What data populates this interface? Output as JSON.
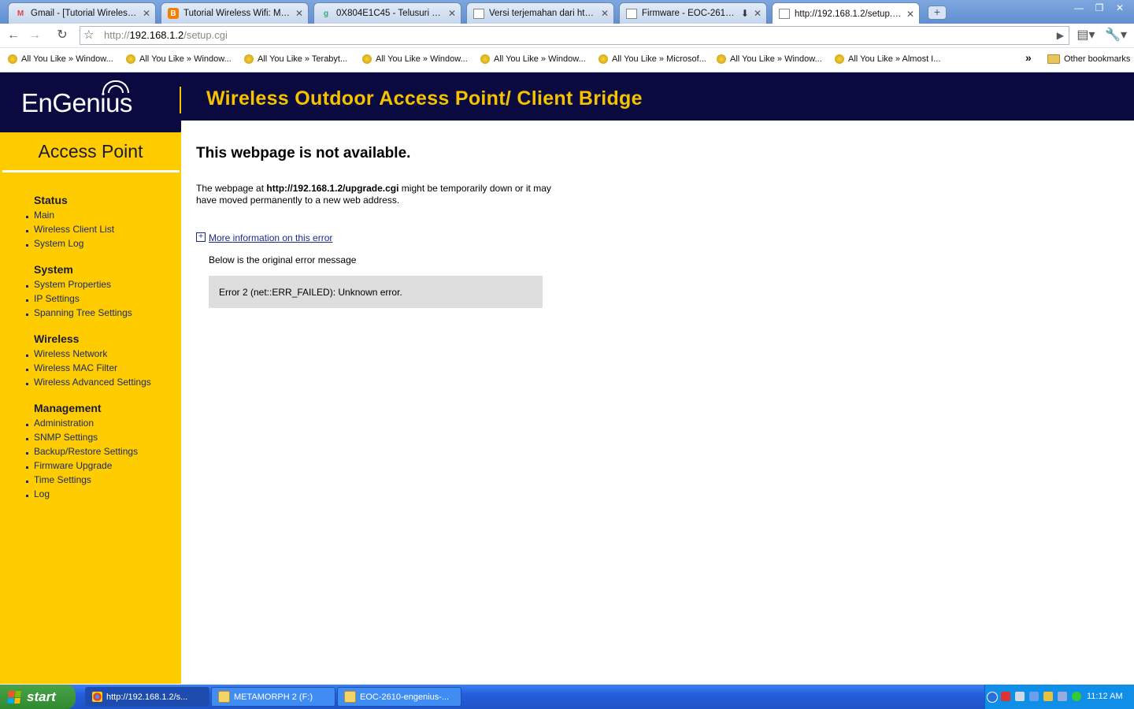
{
  "browser": {
    "tabs": [
      {
        "title": "Gmail - [Tutorial Wireless W...",
        "icon": "gmail-icon",
        "active": false
      },
      {
        "title": "Tutorial Wireless Wifi: Men...",
        "icon": "blogger-icon",
        "active": false
      },
      {
        "title": "0X804E1C45 - Telusuri den...",
        "icon": "google-icon",
        "active": false
      },
      {
        "title": "Versi terjemahan dari http:...",
        "icon": "page-icon",
        "active": false
      },
      {
        "title": "Firmware - EOC-2610 - ...",
        "icon": "page-icon",
        "active": false
      },
      {
        "title": "http://192.168.1.2/setup.cgi",
        "icon": "page-icon",
        "active": true
      }
    ],
    "address": {
      "prefix": "http://",
      "host": "192.168.1.2",
      "path": "/setup.cgi"
    },
    "bookmarks": [
      "All You Like » Window...",
      "All You Like » Window...",
      "All You Like » Terabyt...",
      "All You Like » Window...",
      "All You Like » Window...",
      "All You Like » Microsof...",
      "All You Like » Window...",
      "All You Like » Almost I..."
    ],
    "overflow": "»",
    "other_bookmarks": "Other bookmarks"
  },
  "header": {
    "logo": "EnGenius",
    "title": "Wireless Outdoor Access Point/ Client Bridge"
  },
  "sidebar": {
    "title": "Access Point",
    "sections": [
      {
        "heading": "Status",
        "items": [
          "Main",
          "Wireless Client List",
          "System Log"
        ]
      },
      {
        "heading": "System",
        "items": [
          "System Properties",
          "IP Settings",
          "Spanning Tree Settings"
        ]
      },
      {
        "heading": "Wireless",
        "items": [
          "Wireless Network",
          "Wireless MAC Filter",
          "Wireless Advanced Settings"
        ]
      },
      {
        "heading": "Management",
        "items": [
          "Administration",
          "SNMP Settings",
          "Backup/Restore Settings",
          "Firmware Upgrade",
          "Time Settings",
          "Log"
        ]
      }
    ]
  },
  "error": {
    "title": "This webpage is not available.",
    "desc_before": "The webpage at ",
    "desc_url": "http://192.168.1.2/upgrade.cgi",
    "desc_after": " might be temporarily down or it may have moved permanently to a new web address.",
    "more_link": "More information on this error",
    "below": "Below is the original error message",
    "code": "Error 2 (net::ERR_FAILED): Unknown error."
  },
  "taskbar": {
    "start": "start",
    "tasks": [
      {
        "label": "http://192.168.1.2/s...",
        "icon": "chrome-icon",
        "active": true
      },
      {
        "label": "METAMORPH 2 (F:)",
        "icon": "folder-icon",
        "active": false
      },
      {
        "label": "EOC-2610-engenius-...",
        "icon": "folder-icon",
        "active": false
      }
    ],
    "clock": "11:12 AM"
  },
  "colors": {
    "header_bg": "#0b0a40",
    "sidebar_bg": "#ffcc00",
    "title_yellow": "#f5c200",
    "error_box": "#dedede"
  }
}
